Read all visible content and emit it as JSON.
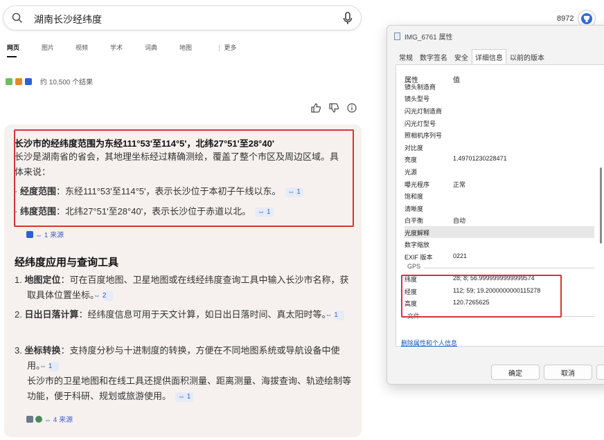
{
  "search": {
    "query": "湖南长沙经纬度",
    "tabs": [
      "网页",
      "图片",
      "视频",
      "学术",
      "词典",
      "地图",
      "更多"
    ],
    "result_count": "约 10,500 个结果"
  },
  "user": {
    "points": "8972"
  },
  "answer": {
    "heading1": "长沙市的经纬度范围为东经111°53'至114°5'，北纬27°51'至28°40'",
    "intro": "长沙是湖南省的省会，其地理坐标经过精确测绘，覆盖了整个市区及周边区域。具体来说：",
    "bullets": [
      {
        "term": "经度范围",
        "text": "：东经111°53'至114°5'，表示长沙位于本初子午线以东。",
        "cite": "⇔ 1"
      },
      {
        "term": "纬度范围",
        "text": "：北纬27°51'至28°40'，表示长沙位于赤道以北。",
        "cite": "⇔ 1"
      }
    ],
    "source1": "⇔ 1 来源",
    "heading2": "经纬度应用与查询工具",
    "items": [
      {
        "num": "1.",
        "term": "地图定位",
        "text": "：可在百度地图、卫星地图或在线经纬度查询工具中输入长沙市名称，获取具体位置坐标。",
        "cite": "⇔ 2"
      },
      {
        "num": "2.",
        "term": "日出日落计算",
        "text": "：经纬度信息可用于天文计算，如日出日落时间、真太阳时等。",
        "cite": "⇔ 1"
      },
      {
        "num": "3.",
        "term": "坐标转换",
        "text": "：支持度分秒与十进制度的转换，方便在不同地图系统或导航设备中使用。",
        "cite": "⇔ 1"
      }
    ],
    "extra": "长沙市的卫星地图和在线工具还提供面积测量、距离测量、海拔查询、轨迹绘制等功能，便于科研、规划或旅游使用。",
    "extra_cite": "⇔ 1",
    "source2": "⇔ 4 来源"
  },
  "dialog": {
    "title": "IMG_6761 属性",
    "tabs": [
      "常规",
      "数字签名",
      "安全",
      "详细信息",
      "以前的版本"
    ],
    "header_key": "属性",
    "header_val": "值",
    "rows": [
      {
        "k": "镜头制造商",
        "v": ""
      },
      {
        "k": "镜头型号",
        "v": ""
      },
      {
        "k": "闪光灯制造商",
        "v": ""
      },
      {
        "k": "闪光灯型号",
        "v": ""
      },
      {
        "k": "照相机序列号",
        "v": ""
      },
      {
        "k": "对比度",
        "v": ""
      },
      {
        "k": "亮度",
        "v": "1.49701230228471"
      },
      {
        "k": "光源",
        "v": ""
      },
      {
        "k": "曝光程序",
        "v": "正常"
      },
      {
        "k": "饱和度",
        "v": ""
      },
      {
        "k": "清晰度",
        "v": ""
      },
      {
        "k": "白平衡",
        "v": "自动"
      },
      {
        "k": "光度解释",
        "v": ""
      },
      {
        "k": "数字缩放",
        "v": ""
      },
      {
        "k": "EXIF 版本",
        "v": "0221"
      }
    ],
    "gps_label": "GPS",
    "gps_rows": [
      {
        "k": "纬度",
        "v": "28; 8; 56.9999999999999574"
      },
      {
        "k": "经度",
        "v": "112; 59; 19.2000000000115278"
      },
      {
        "k": "高度",
        "v": "120.7265625"
      }
    ],
    "file_label": "文件",
    "remove_link": "删除属性和个人信息",
    "ok": "确定",
    "cancel": "取消"
  }
}
